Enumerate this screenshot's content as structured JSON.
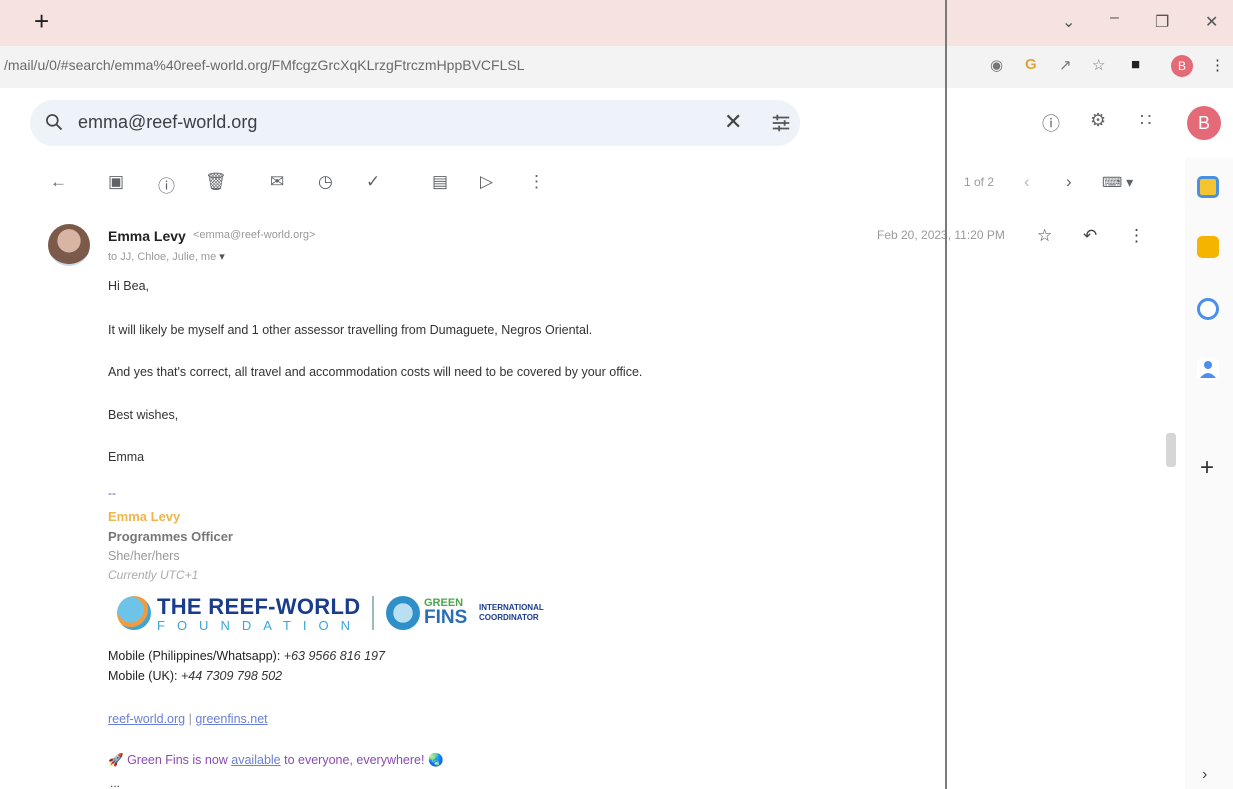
{
  "browser": {
    "new_tab": "+",
    "url": "/mail/u/0/#search/emma%40reef-world.org/FMfcgzGrcXqKLrzgFtrczmHppBVCFLSL",
    "profile_initial": "B",
    "window_controls": [
      "chevron-down-icon",
      "minimize-icon",
      "restore-icon",
      "close-icon"
    ]
  },
  "gmail": {
    "search_query": "emma@reef-world.org",
    "account_initial": "B",
    "pager": "1 of 2"
  },
  "message": {
    "sender_name": "Emma Levy",
    "sender_email": "<emma@reef-world.org>",
    "recipients": "to JJ, Chloe, Julie, me",
    "date": "Feb 20, 2023, 11:20 PM",
    "greeting": "Hi Bea,",
    "para1": "It will likely be myself and 1 other assessor travelling from Dumaguete, Negros Oriental.",
    "para2": "And yes that's correct, all travel and accommodation costs will need to be covered by your office.",
    "closing": "Best wishes,",
    "signoff": "Emma"
  },
  "signature": {
    "separator": "--",
    "name": "Emma Levy",
    "title": "Programmes Officer",
    "pronouns": "She/her/hers",
    "timezone": "Currently UTC+1",
    "logo_reef": "THE REEF-WORLD",
    "logo_foundation": "FOUNDATION",
    "logo_green": "GREEN",
    "logo_fins": "FINS",
    "logo_intl_1": "INTERNATIONAL",
    "logo_intl_2": "COORDINATOR",
    "mobile_ph_label": "Mobile (Philippines/Whatsapp):",
    "mobile_ph": "+63 9566 816 197",
    "mobile_uk_label": "Mobile (UK):",
    "mobile_uk": "+44 7309 798 502",
    "link1": "reef-world.org",
    "link_sep": "|",
    "link2": "greenfins.net",
    "gf_prefix": "Green Fins is now",
    "gf_link": "available",
    "gf_suffix": "to everyone, everywhere!",
    "more": "..."
  },
  "colors": {
    "accent": "#e46a78",
    "signature_name": "#f0b44a",
    "link": "#6a7fd6"
  }
}
